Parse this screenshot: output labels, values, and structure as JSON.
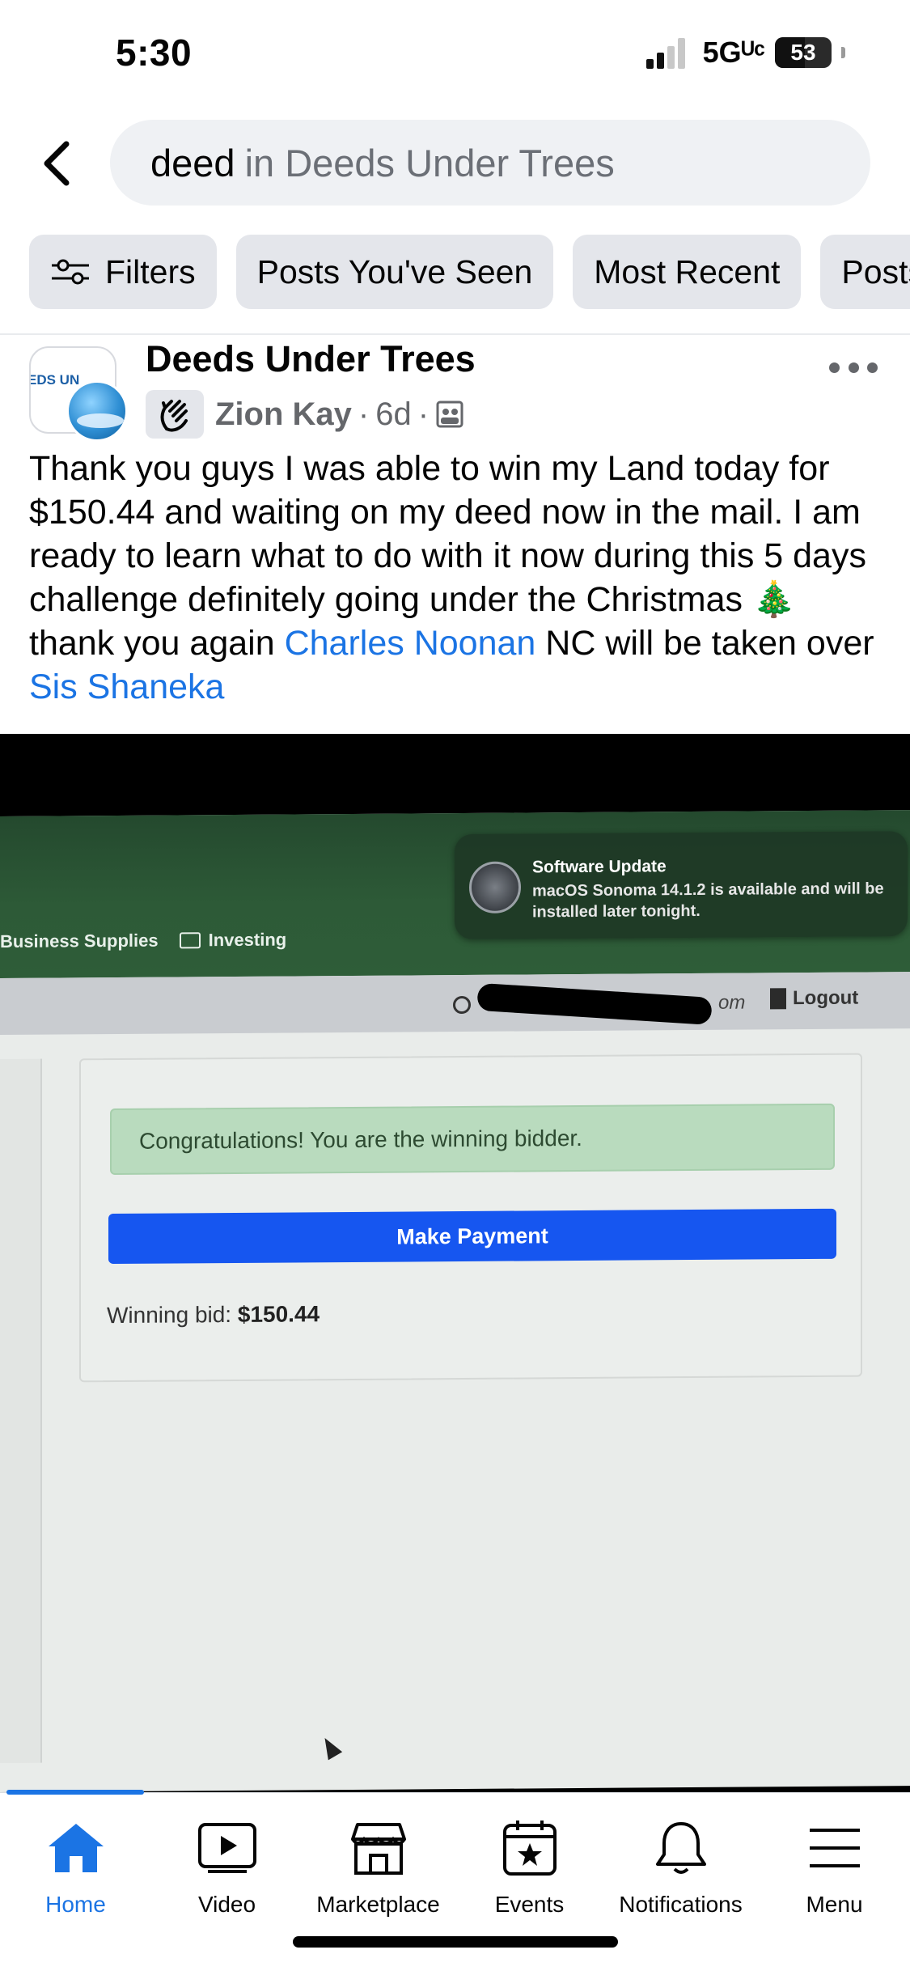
{
  "status_bar": {
    "time": "5:30",
    "network": "5Gᵁᶜ",
    "battery": "53"
  },
  "search": {
    "query": "deed",
    "scope": "in Deeds Under Trees"
  },
  "filters": [
    {
      "label": "Filters"
    },
    {
      "label": "Posts You've Seen"
    },
    {
      "label": "Most Recent"
    },
    {
      "label": "Posts"
    }
  ],
  "post": {
    "group_name": "Deeds Under Trees",
    "group_avatar_text": "EDS UN",
    "author": "Zion Kay",
    "time_ago": "6d",
    "sep": "·",
    "text_1": "Thank you guys I was able to win my Land today for $150.44 and waiting on my deed now in the mail. I am ready to learn what to do with it now during this 5 days challenge definitely going under the Christmas 🎄 thank you again ",
    "mention_1": "Charles Noonan",
    "text_2": " NC will be taken over ",
    "mention_2": "Sis Shaneka"
  },
  "photo": {
    "notification_title": "Software Update",
    "notification_text": "macOS Sonoma 14.1.2 is available and will be installed later tonight.",
    "bookmarks": [
      "Business Supplies",
      "Investing"
    ],
    "user_suffix": "om",
    "logout_label": "Logout",
    "alert_text": "Congratulations! You are the winning bidder.",
    "pay_button_label": "Make Payment",
    "winning_bid_label": "Winning bid:",
    "winning_bid_value": "$150.44"
  },
  "tabs": [
    {
      "label": "Home",
      "icon": "home-icon",
      "active": true
    },
    {
      "label": "Video",
      "icon": "video-icon"
    },
    {
      "label": "Marketplace",
      "icon": "marketplace-icon"
    },
    {
      "label": "Events",
      "icon": "events-icon"
    },
    {
      "label": "Notifications",
      "icon": "bell-icon"
    },
    {
      "label": "Menu",
      "icon": "menu-icon"
    }
  ],
  "colors": {
    "accent": "#1b74e4",
    "success": "#b9dbbe",
    "pay_button": "#1656f0",
    "browser_green": "#2d5a37"
  }
}
